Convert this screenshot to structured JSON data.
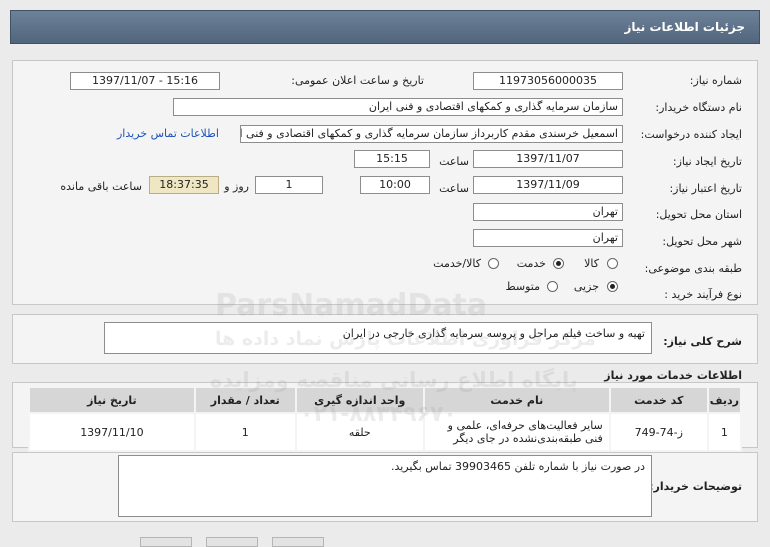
{
  "header": {
    "title": "جزئیات اطلاعات نیاز"
  },
  "form": {
    "need_number_label": "شماره نیاز:",
    "need_number": "11973056000035",
    "announce_label": "تاریخ و ساعت اعلان عمومی:",
    "announce_value": "1397/11/07 - 15:16",
    "buyer_label": "نام دستگاه خریدار:",
    "buyer": "سازمان سرمایه گذاری و کمکهای اقتصادی و فنی ایران",
    "creator_label": "ایجاد کننده درخواست:",
    "creator": "اسمعیل خرسندی مقدم کاربرداز سازمان سرمایه گذاری و کمکهای اقتصادی و فنی ایران",
    "contact_link": "اطلاعات تماس خریدار",
    "created_label": "تاریخ ایجاد نیاز:",
    "created_date": "1397/11/07",
    "time_label": "ساعت",
    "created_time": "15:15",
    "validity_label": "تاریخ اعتبار نیاز:",
    "validity_date": "1397/11/09",
    "validity_time": "10:00",
    "days": "1",
    "days_label": "روز و",
    "remaining": "18:37:35",
    "remaining_label": "ساعت باقی مانده",
    "province_label": "استان محل تحویل:",
    "province": "تهران",
    "city_label": "شهر محل تحویل:",
    "city": "تهران",
    "category_label": "طبقه بندی موضوعی:",
    "category_options": [
      "کالا",
      "خدمت",
      "کالا/خدمت"
    ],
    "category_selected": "خدمت",
    "process_label": "نوع فرآیند خرید :",
    "process_options": [
      "جزیی",
      "متوسط"
    ],
    "process_selected": "جزیی"
  },
  "summary": {
    "label": "شرح کلی نیاز:",
    "text": "تهیه و ساخت فیلم مراحل و پروسه سرمایه گذاری خارجی در ایران"
  },
  "services": {
    "title": "اطلاعات خدمات مورد نیاز",
    "columns": [
      "ردیف",
      "کد خدمت",
      "نام خدمت",
      "واحد اندازه گیری",
      "تعداد / مقدار",
      "تاریخ نیاز"
    ],
    "rows": [
      [
        "1",
        "ز-74-749",
        "سایر فعالیت‌های حرفه‌ای، علمی و فنی طبقه‌بندی‌نشده در جای دیگر",
        "حلقه",
        "1",
        "1397/11/10"
      ]
    ]
  },
  "buyer_notes": {
    "label": "توضیحات خریدار:",
    "text": "در صورت نیاز با شماره تلفن 39903465 تماس بگیرید."
  },
  "watermark": {
    "brand": "ParsNamadData",
    "line1": "مرکز فراوری اطلاعات پارس نماد داده ها",
    "line2": "پایگاه اطلاع رسانی مناقصه ومزایده",
    "phone": "۰۲۱-۸۸۳۴۹۶۷۰"
  },
  "colors": {
    "header": "#5d7289",
    "link": "#1f52b8",
    "highlight": "#efe6c3"
  }
}
